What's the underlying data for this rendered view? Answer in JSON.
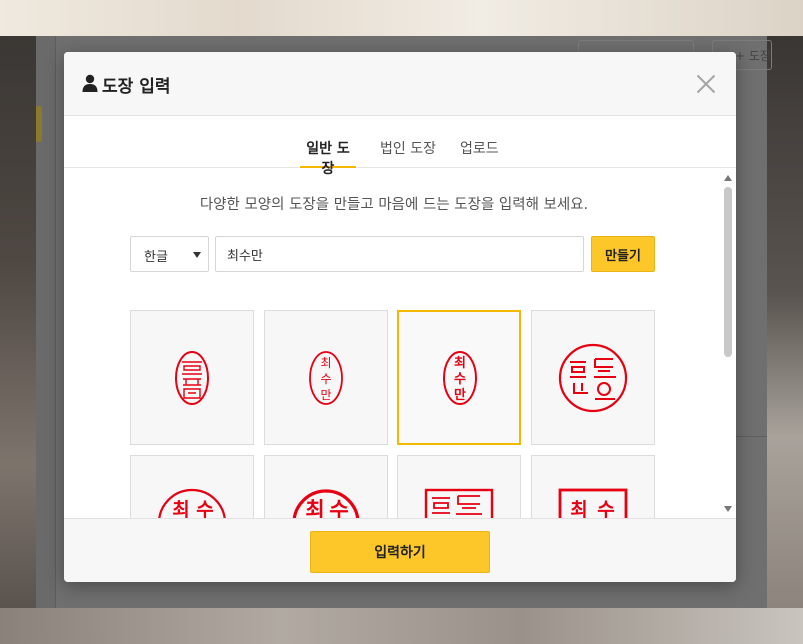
{
  "modal": {
    "title": "도장 입력",
    "header_icon": "user-icon",
    "close_icon": "close-icon"
  },
  "tabs": [
    {
      "label": "일반 도장",
      "active": true
    },
    {
      "label": "법인 도장",
      "active": false
    },
    {
      "label": "업로드",
      "active": false
    }
  ],
  "instruction": "다양한 모양의 도장을 만들고 마음에 드는 도장을 입력해 보세요.",
  "form": {
    "script_select": "한글",
    "name_value": "최수만",
    "make_button": "만들기"
  },
  "stamps": {
    "name": "최수만",
    "selected_index": 2,
    "items": [
      {
        "style": "oval-seal-script"
      },
      {
        "style": "oval-plain"
      },
      {
        "style": "oval-bold"
      },
      {
        "style": "round-seal-script"
      },
      {
        "style": "round-bold-light"
      },
      {
        "style": "round-bold-heavy"
      },
      {
        "style": "square-seal-script"
      },
      {
        "style": "square-bold"
      }
    ]
  },
  "underlying_page": {
    "toolbar_button": "+ 도장"
  },
  "footer": {
    "submit_button": "입력하기"
  },
  "colors": {
    "accent": "#fdc72a",
    "stamp_red": "#e60012",
    "selected_border": "#f5b800"
  }
}
